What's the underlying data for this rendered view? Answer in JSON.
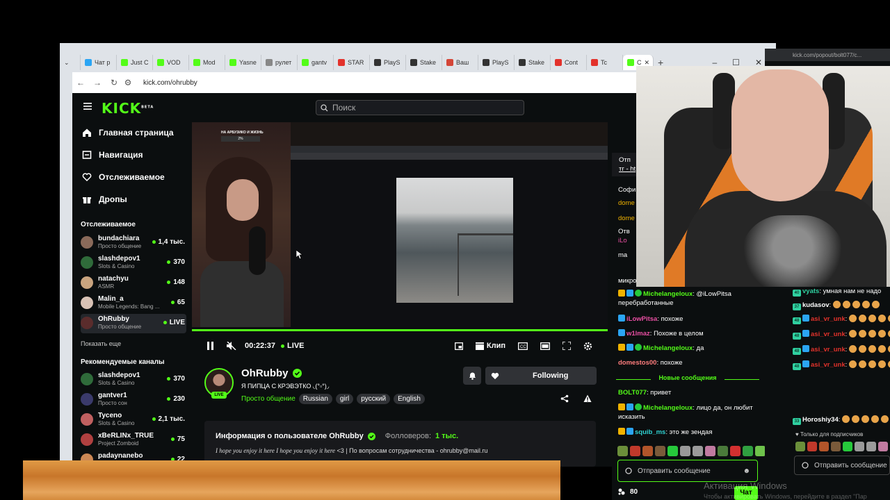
{
  "browser": {
    "tabs": [
      {
        "label": "Чат р",
        "color": "#2ba5f4"
      },
      {
        "label": "Just C",
        "color": "#53fc18"
      },
      {
        "label": "VOD",
        "color": "#53fc18"
      },
      {
        "label": "Mod",
        "color": "#53fc18"
      },
      {
        "label": "Yasne",
        "color": "#53fc18"
      },
      {
        "label": "рулет",
        "color": "#888888"
      },
      {
        "label": "gantv",
        "color": "#53fc18"
      },
      {
        "label": "STAR",
        "color": "#e3322b"
      },
      {
        "label": "PlayS",
        "color": "#333333"
      },
      {
        "label": "Stake",
        "color": "#333333"
      },
      {
        "label": "Ваш",
        "color": "#d44638"
      },
      {
        "label": "PlayS",
        "color": "#333333"
      },
      {
        "label": "Stake",
        "color": "#333333"
      },
      {
        "label": "Cont",
        "color": "#e3322b"
      },
      {
        "label": "Tc",
        "color": "#e3322b"
      },
      {
        "label": "C",
        "color": "#53fc18"
      }
    ],
    "url": "kick.com/ohrubby"
  },
  "kick": {
    "logo": "KICK",
    "logo_sup": "BETA",
    "search_placeholder": "Поиск",
    "nav": {
      "home": "Главная страница",
      "browse": "Навигация",
      "following": "Отслеживаемое",
      "drops": "Дропы"
    },
    "following_heading": "Отслеживаемое",
    "following_channels": [
      {
        "name": "bundachiara",
        "category": "Просто общение",
        "count": "1,4 тыс.",
        "live": false,
        "avatar": "#8a6a5a"
      },
      {
        "name": "slashdepov1",
        "category": "Slots & Casino",
        "count": "370",
        "live": false,
        "avatar": "#2f6b3a"
      },
      {
        "name": "natachyu",
        "category": "ASMR",
        "count": "148",
        "live": false,
        "avatar": "#c9a47f"
      },
      {
        "name": "Malin_a",
        "category": "Mobile Legends: Bang ...",
        "count": "65",
        "live": false,
        "avatar": "#d8c2b5"
      },
      {
        "name": "OhRubby",
        "category": "Просто общение",
        "count": "LIVE",
        "live": true,
        "avatar": "#5a2c2c"
      }
    ],
    "show_more": "Показать еще",
    "recommended_heading": "Рекомендуемые каналы",
    "recommended_channels": [
      {
        "name": "slashdepov1",
        "category": "Slots & Casino",
        "count": "370",
        "avatar": "#2f6b3a"
      },
      {
        "name": "gantver1",
        "category": "Просто сон",
        "count": "230",
        "avatar": "#3a3a6b"
      },
      {
        "name": "Tyceno",
        "category": "Slots & Casino",
        "count": "2,1 тыс.",
        "avatar": "#c06060"
      },
      {
        "name": "xBeRLINx_TRUE",
        "category": "Project Zomboid",
        "count": "75",
        "avatar": "#b04040"
      },
      {
        "name": "padaynanebo",
        "category": "",
        "count": "22",
        "avatar": "#cc8855"
      }
    ],
    "video": {
      "overlay_title": "НА АРБУЗИКО И ЖИЗНЬ",
      "overlay_value": "2%",
      "time": "00:22:37",
      "live_label": "LIVE",
      "clip_label": "Клип"
    },
    "channel": {
      "name": "OhRubby",
      "live_badge": "LIVE",
      "title": "Я ПИПЦА С КРЭВЭТКО ◟(°▫°)◞",
      "category": "Просто общение",
      "tags": [
        "Russian",
        "girl",
        "русский",
        "English"
      ],
      "follow_label": "Following"
    },
    "about": {
      "title": "Информация о пользователе OhRubby",
      "followers_label": "Фолловеров:",
      "followers_value": "1 тыс.",
      "desc_italic": "I hope you enjoy it here I hope you enjoy it here",
      "desc_rest": "<3 | По вопросам сотрудничества - ohrubby@mail.ru"
    }
  },
  "chat": {
    "pinned_label": "Отп",
    "pinned_text": "тг - ht",
    "partial_lines": [
      "Софи",
      "dome",
      "dome",
      "Отв",
      "iLo",
      "ma",
      "",
      "микро"
    ],
    "messages": [
      {
        "user": "Michelangeloux",
        "color": "#53fc18",
        "text": " @iLowPitsa перебработанные",
        "badges": [
          "gold",
          "blue",
          "green"
        ]
      },
      {
        "user": "iLowPitsa",
        "color": "#e94fa3",
        "text": " похоже",
        "badges": [
          "blue"
        ]
      },
      {
        "user": "w1lmaz",
        "color": "#e94fa3",
        "text": " Похоже в целом",
        "badges": [
          "blue"
        ]
      },
      {
        "user": "Michelangeloux",
        "color": "#53fc18",
        "text": " да",
        "badges": [
          "gold",
          "blue",
          "green"
        ]
      },
      {
        "user": "domestos00",
        "color": "#ff7d7d",
        "text": " похоже",
        "badges": []
      },
      {
        "user": "BOLT077",
        "color": "#53fc18",
        "text": " привет",
        "badges": []
      },
      {
        "user": "Michelangeloux",
        "color": "#53fc18",
        "text": " лицо да, он любит исказить",
        "badges": [
          "gold",
          "blue",
          "green"
        ]
      },
      {
        "user": "squib_ms",
        "color": "#2fd0d0",
        "text": " это же зендая",
        "badges": [
          "gold",
          "blue"
        ]
      }
    ],
    "new_messages": "Новые сообщения",
    "input_placeholder": "Отправить сообщение",
    "points": "80",
    "chat_button": "Чат"
  },
  "popout": {
    "url": "kick.com/popout/bolt077/c...",
    "messages": [
      {
        "level": "40",
        "user": "vyats",
        "color": "#2fd0a0",
        "text": " умная нам не надо"
      },
      {
        "level": "37",
        "user": "kudasov",
        "color": "#ffffff",
        "text": ""
      },
      {
        "level": "48",
        "user": "asi_vr_unk",
        "color": "#e3322b",
        "text": ""
      },
      {
        "level": "48",
        "user": "asi_vr_unk",
        "color": "#e3322b",
        "text": ""
      },
      {
        "level": "48",
        "user": "asi_vr_unk",
        "color": "#e3322b",
        "text": ""
      },
      {
        "level": "48",
        "user": "asi_vr_unk",
        "color": "#e3322b",
        "text": ""
      },
      {
        "level": "33",
        "user": "Horoshiy34",
        "color": "#ffffff",
        "text": ""
      }
    ],
    "subscribers_only": "Только для подписчиков",
    "input_placeholder": "Отправить сообщение"
  },
  "watermark": {
    "line1": "Активация Windows",
    "line2": "Чтобы активировать Windows, перейдите в раздел \"Пар"
  }
}
